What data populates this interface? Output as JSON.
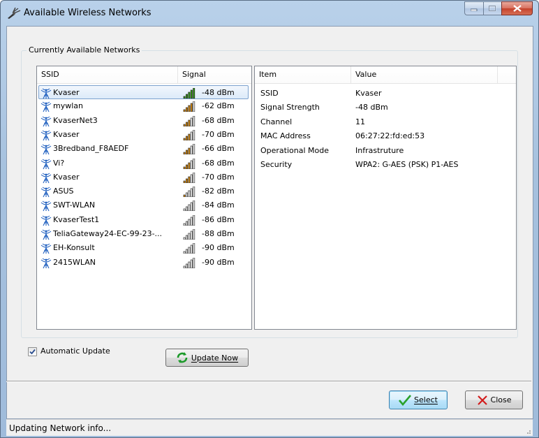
{
  "window": {
    "title": "Available Wireless Networks"
  },
  "group": {
    "label": "Currently Available  Networks"
  },
  "network_list": {
    "columns": [
      "SSID",
      "Signal"
    ],
    "rows": [
      {
        "ssid": "Kvaser",
        "signal": "-48 dBm",
        "bars": 5,
        "color": "#2e9a0f",
        "selected": true
      },
      {
        "ssid": "mywlan",
        "signal": "-62 dBm",
        "bars": 4,
        "color": "#e08a00",
        "selected": false
      },
      {
        "ssid": "KvaserNet3",
        "signal": "-68 dBm",
        "bars": 3,
        "color": "#e08a00",
        "selected": false
      },
      {
        "ssid": "Kvaser",
        "signal": "-70 dBm",
        "bars": 3,
        "color": "#e08a00",
        "selected": false
      },
      {
        "ssid": "3Bredband_F8AEDF",
        "signal": "-66 dBm",
        "bars": 3,
        "color": "#e08a00",
        "selected": false
      },
      {
        "ssid": "Vi?",
        "signal": "-68 dBm",
        "bars": 3,
        "color": "#e08a00",
        "selected": false
      },
      {
        "ssid": "Kvaser",
        "signal": "-70 dBm",
        "bars": 3,
        "color": "#e08a00",
        "selected": false
      },
      {
        "ssid": "ASUS",
        "signal": "-82 dBm",
        "bars": 1,
        "color": "#e08a00",
        "selected": false
      },
      {
        "ssid": "SWT-WLAN",
        "signal": "-84 dBm",
        "bars": 0,
        "color": "#e08a00",
        "selected": false
      },
      {
        "ssid": "KvaserTest1",
        "signal": "-86 dBm",
        "bars": 0,
        "color": "#e08a00",
        "selected": false
      },
      {
        "ssid": "TeliaGateway24-EC-99-23-...",
        "signal": "-88 dBm",
        "bars": 0,
        "color": "#e08a00",
        "selected": false
      },
      {
        "ssid": "EH-Konsult",
        "signal": "-90 dBm",
        "bars": 0,
        "color": "#e08a00",
        "selected": false
      },
      {
        "ssid": "2415WLAN",
        "signal": "-90 dBm",
        "bars": 0,
        "color": "#e08a00",
        "selected": false
      }
    ]
  },
  "details": {
    "columns": [
      "Item",
      "Value"
    ],
    "rows": [
      {
        "item": "SSID",
        "value": "Kvaser"
      },
      {
        "item": "Signal Strength",
        "value": "-48 dBm"
      },
      {
        "item": "Channel",
        "value": "11"
      },
      {
        "item": "MAC Address",
        "value": "06:27:22:fd:ed:53"
      },
      {
        "item": "Operational Mode",
        "value": "Infrastruture"
      },
      {
        "item": "Security",
        "value": "WPA2: G-AES (PSK) P1-AES"
      }
    ]
  },
  "auto_update": {
    "label": "Automatic Update",
    "checked": true
  },
  "buttons": {
    "update_now": "Update Now",
    "select": "Select",
    "close": "Close"
  },
  "status": {
    "text": "Updating Network info..."
  }
}
